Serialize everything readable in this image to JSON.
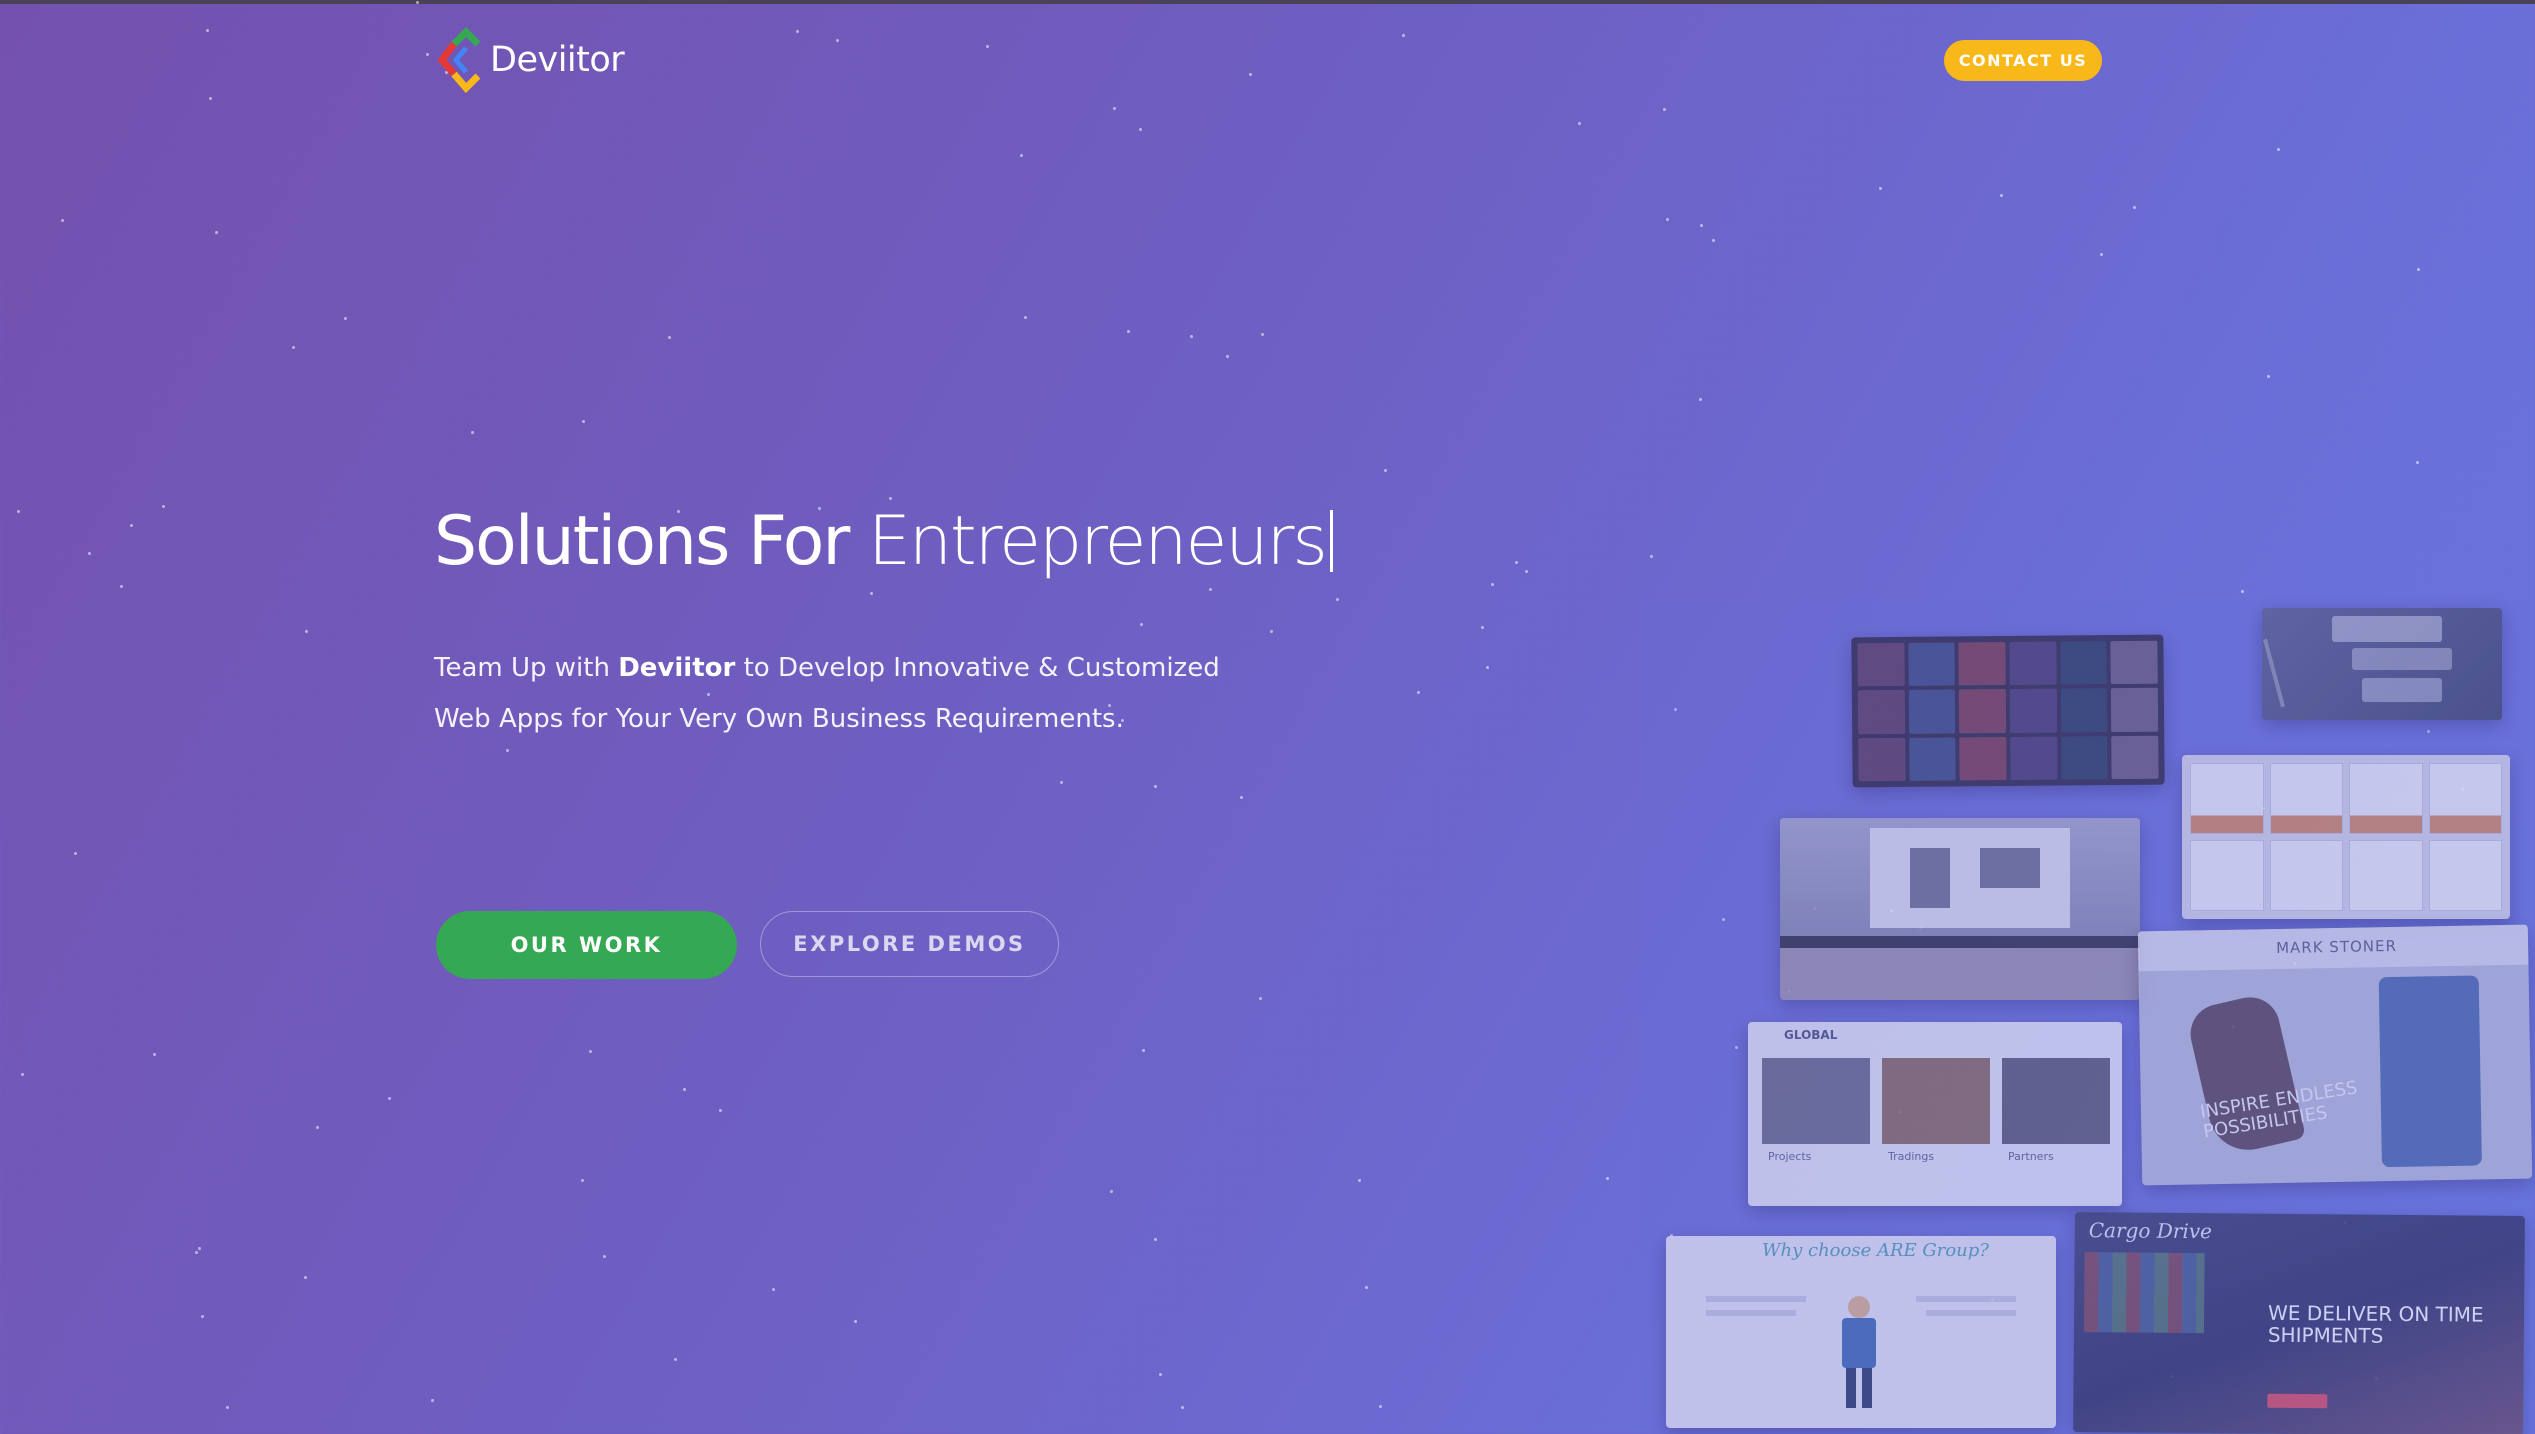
{
  "brand": {
    "name": "Deviitor",
    "colors": {
      "green": "#34a853",
      "yellow": "#f8b81a",
      "red": "#e53935",
      "blue": "#4285f4"
    }
  },
  "header": {
    "contact_label": "CONTACT US"
  },
  "hero": {
    "title_static": "Solutions For",
    "title_dynamic": "Entrepreneurs",
    "subtitle_prefix": "Team Up with",
    "subtitle_brand": "Deviitor",
    "subtitle_rest": "to Develop Innovative & Customized",
    "subtitle_line2": "Web Apps for Your Very Own Business Requirements.",
    "buttons": {
      "our_work": "OUR WORK",
      "explore_demos": "EXPLORE DEMOS"
    }
  },
  "showcase": {
    "mark_stoner_title": "MARK STONER",
    "mark_stoner_tagline": "INSPIRE ENDLESS POSSIBILITIES",
    "global_title": "GLOBAL",
    "global_cols": [
      "Projects",
      "Tradings",
      "Partners"
    ],
    "are_heading": "Why choose ARE Group?",
    "cargo_logo": "Cargo Drive",
    "cargo_headline": "WE DELIVER ON TIME SHIPMENTS"
  }
}
